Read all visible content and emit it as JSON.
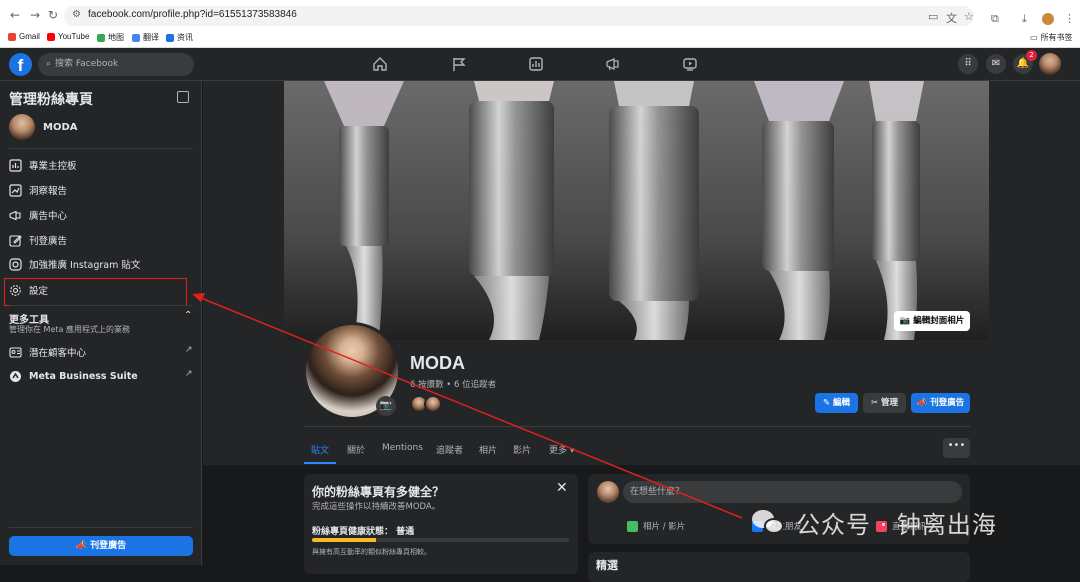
{
  "browser": {
    "url": "facebook.com/profile.php?id=61551373583846",
    "bookmarks": [
      "Gmail",
      "YouTube",
      "地图",
      "翻译",
      "资讯"
    ],
    "all_bookmarks": "所有书签"
  },
  "facebook": {
    "search_placeholder": "搜索 Facebook",
    "notification_count": "2"
  },
  "sidebar": {
    "title": "管理粉絲專頁",
    "page_name": "MODA",
    "items": [
      {
        "label": "專業主控板",
        "icon": "dashboard-icon"
      },
      {
        "label": "洞察報告",
        "icon": "insights-icon"
      },
      {
        "label": "廣告中心",
        "icon": "megaphone-icon"
      },
      {
        "label": "刊登廣告",
        "icon": "edit-icon"
      },
      {
        "label": "加強推廣 Instagram 貼文",
        "icon": "instagram-icon"
      },
      {
        "label": "設定",
        "icon": "gear-icon"
      }
    ],
    "more_tools": {
      "title": "更多工具",
      "desc": "管理你在 Meta 應用程式上的業務",
      "items": [
        {
          "label": "潛在顧客中心",
          "icon": "id-card-icon"
        },
        {
          "label": "Meta Business Suite",
          "icon": "meta-icon"
        }
      ]
    },
    "promote_button": "刊登廣告"
  },
  "profile": {
    "cover_edit": "編輯封面相片",
    "name": "MODA",
    "stats": "6 按讚數 • 6 位追蹤者",
    "buttons": {
      "edit": "編輯",
      "manage": "管理",
      "promote": "刊登廣告"
    },
    "tabs": [
      "貼文",
      "關於",
      "Mentions",
      "追蹤者",
      "相片",
      "影片",
      "更多"
    ],
    "more_tab_button": "•••"
  },
  "health_card": {
    "title": "你的粉絲專頁有多健全？",
    "subtitle": "完成這些操作以持續改善MODA。",
    "label": "粉絲專頁健康狀態： 普通",
    "progress": 0.25,
    "note": "與擁有高互動率的類似粉絲專頁相較。"
  },
  "composer": {
    "placeholder": "在想些什麼？",
    "actions": [
      "相片 / 影片",
      "標註朋友",
      "直播視訊"
    ]
  },
  "featured_title": "精選",
  "watermark": "公众号 · 钟离出海",
  "colors": {
    "fb_blue": "#1b74e4",
    "dark_bg": "#18191a",
    "surface": "#242526",
    "highlight_red": "#e02020",
    "health_yellow": "#f7b928"
  }
}
